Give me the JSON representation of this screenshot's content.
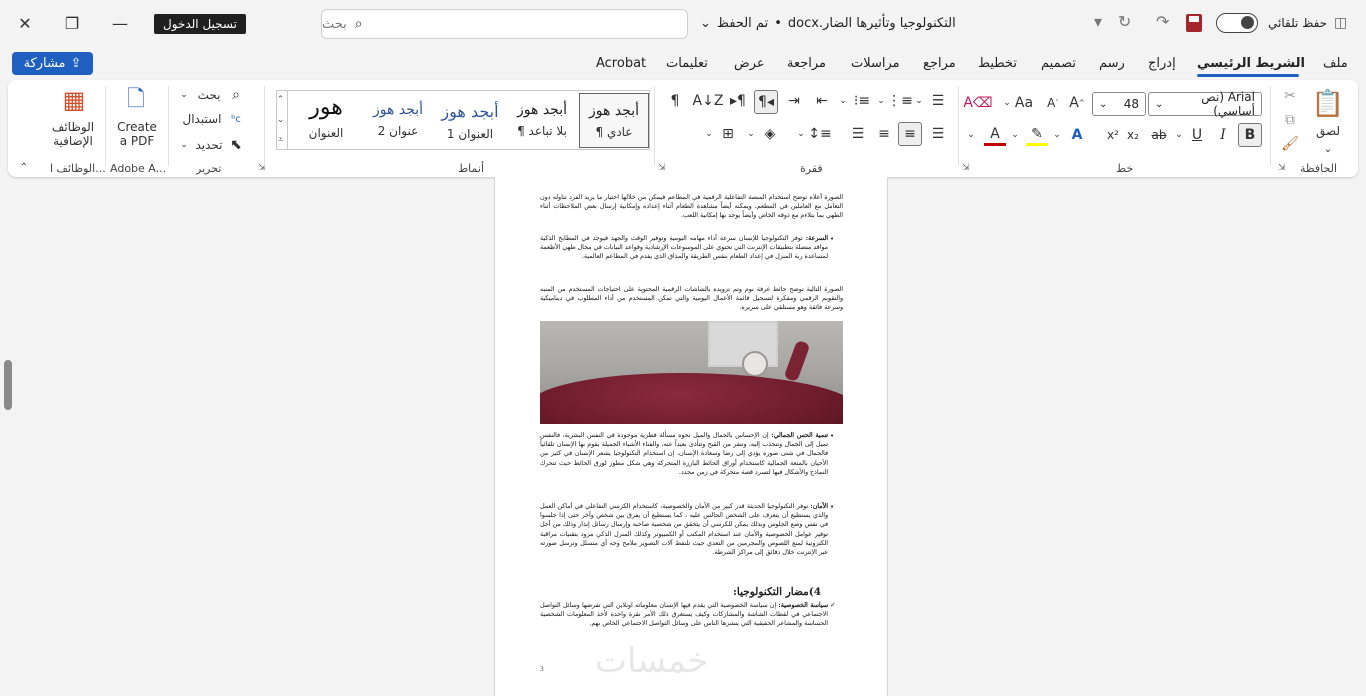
{
  "titlebar": {
    "login_label": "تسجيل الدخول",
    "search_placeholder": "بحث",
    "doc_name": "التكنولوجيا وتأثيرها الضار.docx",
    "save_state": "تم الحفظ",
    "autosave_label": "حفظ تلقائي"
  },
  "tabs": {
    "share_label": "مشاركة",
    "items": [
      "ملف",
      "الشريط الرئيسي",
      "إدراج",
      "رسم",
      "تصميم",
      "تخطيط",
      "مراجع",
      "مراسلات",
      "مراجعة",
      "عرض",
      "تعليمات",
      "Acrobat"
    ],
    "active": "الشريط الرئيسي"
  },
  "ribbon": {
    "clipboard": {
      "label": "الحافظة",
      "paste": "لصق"
    },
    "font": {
      "label": "خط",
      "font_name": "Arial (نص أساسي)",
      "font_size": "48"
    },
    "paragraph": {
      "label": "فقرة"
    },
    "styles": {
      "label": "أنماط",
      "items": [
        {
          "sample": "أبجد هوز",
          "name": "¶ عادي"
        },
        {
          "sample": "أبجد هوز",
          "name": "¶ بلا تباعد"
        },
        {
          "sample": "أبجد هوز",
          "name": "العنوان 1"
        },
        {
          "sample": "أبجد هوز",
          "name": "عنوان 2"
        },
        {
          "sample": "هور",
          "name": "العنوان"
        }
      ]
    },
    "editing": {
      "label": "تحرير",
      "find": "بحث",
      "replace": "استبدال",
      "select": "تحديد"
    },
    "adobe": {
      "label": "Adobe A...",
      "create_pdf": "Create a PDF"
    },
    "addins": {
      "label": "الوظائف ا...",
      "button": "الوظائف الإضافية"
    }
  },
  "document": {
    "p1": "الصورة أعلاه توضح استخدام المنصة التفاعلية الرقمية في المطاعم فيمكن من خلالها اختيار ما يريد الفرد تناوله دون التعامل مع العاملين في المطعم، ويمكنه أيضاً مشاهدة الطعام أثناء إعداده وإمكانية إرسال بعض الملاحظات أثناء الطهي بما يتلاءم مع ذوقه الخاص وأيضاً يوجد بها إمكانية اللعب.",
    "b1_title": "السرعة:",
    "b1_text": " توفر التكنولوجيا للإنسان سرعة أداء مهامه اليومية وتوفير الوقت والجهد فيوجد في المطابخ الذكية مواقد متصلة بتطبيقات الإنترنت التي تحتوي على الموسوعات الإرشادية وقواعد البيانات في مجال طهي الأطعمة لمساعدة ربة المنزل في إعداد الطعام بنفس الطريقة والمذاق الذي يقدم في المطاعم العالمية.",
    "p2": "الصورة التالية توضح حائط غرفة نوم وتم تزويده بالشاشات الرقمية المحتوية على احتياجات المستخدم من المنبه والتقويم الرقمي ومفكرة لتسجيل قائمة الأعمال اليومية والتي تمكن المستخدم من أداء المطلوب في ديناميكية وسرعة فائقة وهو مستلقي على سريره.",
    "b2_title": "تنمية الحس الجمالي:",
    "b2_text": " إن الإحساس بالجمال والميل نحوه مسألة فطرية موجودة في النفس البشرية، فالنفس تميل إلى الجمال وتنجذب إليه، وتنفر من القبح وتتأذى بعيداً عنه، والفناء الأشياء الجميلة يقوم بها الإنسان تلقائياً فالجمال في شتى صوره يؤدي إلى رضا وسعادة الإنسان، إن استخدام التكنولوجيا يشعر الإنسان في كثير من الأحيان بالمتعة الجمالية كاستخدام أوراق الحائط البارزة المتحركة وهي شكل مطور لورق الحائط حيث تتحرك النماذج والأشكال فيها لتسرد قصة متحركة في زمن محدد.",
    "b3_title": "الأمان:",
    "b3_text": " توفر التكنولوجيا الحديثة قدر كبير من الأمان والخصوصية، كاستخدام الكرسي التفاعلي في أماكن العمل والذي يستطيع أن يتعرف على الشخص الجالس عليه ، كما يستطيع أن يفرق بين شخص وآخر حتى إذا جلسوا في نفس وضع الجلوس وبذلك يمكن للكرسي أن يتحقق من شخصية صاحبه وإرسال رسائل إنذار وذلك من أجل توفير عوامل الخصوصية والأمان عند استخدام المكتب أو الكمبيوتر وكذلك المنزل الذكي مزود بتقنيات مراقبة الكترونية لمنع اللصوص والمجرمين من التعدي حيث تلتقط آلات التصوير ملامح وجه أي متسلل وترسل صورته عبر الإنترنت خلال دقائق إلى مراكز الشرطة.",
    "heading": "4)مضار التكنولوجيا:",
    "b4_title": "سياسة الخصوصية:",
    "b4_text": " إن سياسة الخصوصية التي يقدم فيها الإنسان معلوماته اونلاين التي تفرضها وسائل التواصل الاجتماعي في لقطات الشاشة والمشاركات وكيف يستغرق ذلك الأمر نقرة واحدة لأخذ المعلومات الشخصية الحساسة والمشاعر الحقيقية التي ينشرها الناس على وسائل التواصل الاجتماعي الخاص بهم.",
    "page_number": "3",
    "watermark": "خمسات"
  },
  "colors": {
    "accent": "#1f5fbf",
    "font_color": "#c00000",
    "highlight": "#ffff00"
  }
}
